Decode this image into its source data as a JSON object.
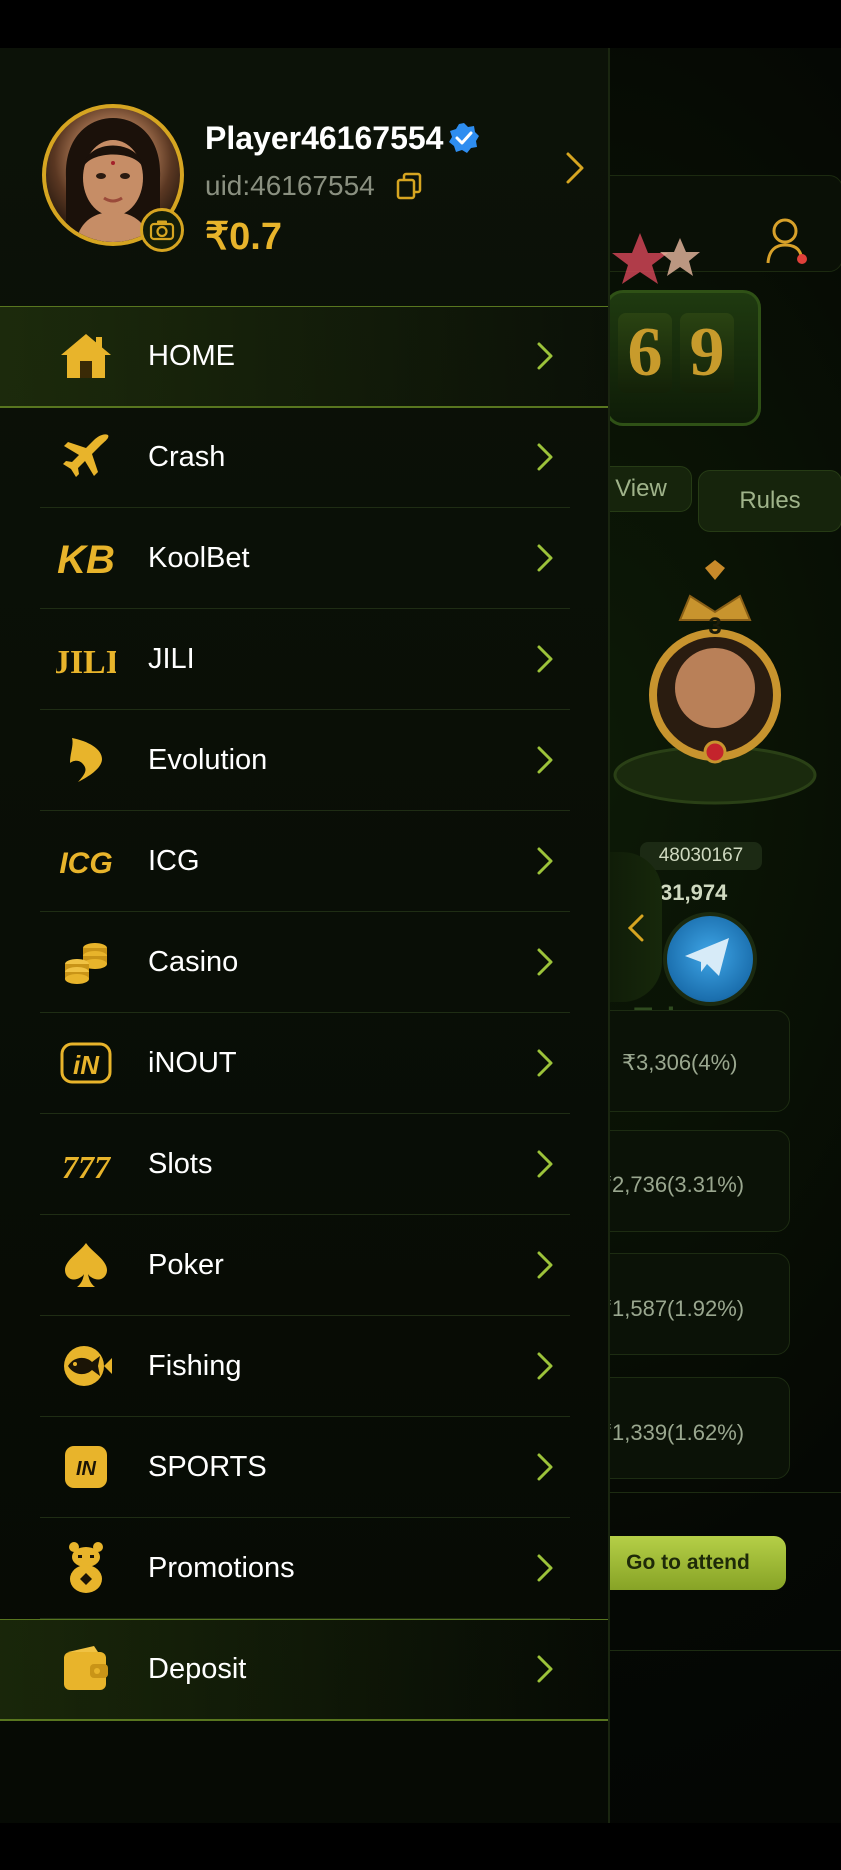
{
  "colors": {
    "accent_gold": "#e8b42b",
    "chevron_green": "#9cc33a",
    "drawer_bg": "#0c1208",
    "active_border": "#58761f"
  },
  "profile": {
    "username": "Player46167554",
    "uid": "uid:46167554",
    "balance": "₹0.7",
    "avatar_icon": "avatar",
    "verified_icon": "verified-check-icon",
    "copy_icon": "copy-icon",
    "camera_icon": "camera-icon"
  },
  "menu": {
    "items": [
      {
        "label": "HOME",
        "icon": "home-icon"
      },
      {
        "label": "Crash",
        "icon": "airplane-icon"
      },
      {
        "label": "KoolBet",
        "icon": "koolbet-logo-icon"
      },
      {
        "label": "JILI",
        "icon": "jili-logo-icon"
      },
      {
        "label": "Evolution",
        "icon": "evolution-logo-icon"
      },
      {
        "label": "ICG",
        "icon": "icg-logo-icon"
      },
      {
        "label": "Casino",
        "icon": "coins-icon"
      },
      {
        "label": "iNOUT",
        "icon": "inout-logo-icon"
      },
      {
        "label": "Slots",
        "icon": "777-slots-icon"
      },
      {
        "label": "Poker",
        "icon": "spade-icon"
      },
      {
        "label": "Fishing",
        "icon": "fish-icon"
      },
      {
        "label": "SPORTS",
        "icon": "sports-logo-icon"
      },
      {
        "label": "Promotions",
        "icon": "gift-bear-icon"
      },
      {
        "label": "Deposit",
        "icon": "wallet-icon"
      }
    ],
    "active_items": [
      "HOME",
      "Deposit"
    ]
  },
  "background": {
    "slot_digits": [
      "6",
      "9"
    ],
    "view_label": "View",
    "rules_label": "Rules",
    "trophy_rank": "3",
    "player_id": "48030167",
    "player_score": "31,974",
    "telegram_label": "Telegram",
    "ranks": [
      "₹3,306(4%)",
      "₹2,736(3.31%)",
      "₹1,587(1.92%)",
      "₹1,339(1.62%)"
    ],
    "attend_button": "Go to attend"
  }
}
